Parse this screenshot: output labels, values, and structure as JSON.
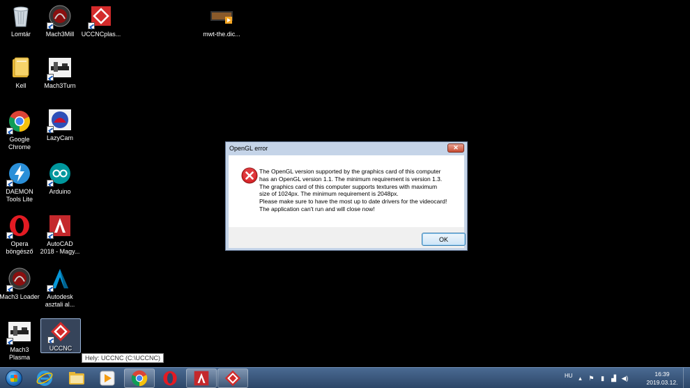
{
  "desktop": {
    "icons": {
      "lomtar": "Lomtár",
      "mach3mill": "Mach3Mill",
      "uccncplas": "UCCNCplas...",
      "mwt": "mwt-the.dic...",
      "kell": "Kell",
      "mach3turn": "Mach3Turn",
      "chrome": "Google\nChrome",
      "lazycam": "LazyCam",
      "daemon": "DAEMON\nTools Lite",
      "arduino": "Arduino",
      "opera": "Opera\nböngésző",
      "autocad": "AutoCAD\n2018 - Magy...",
      "mach3loader": "Mach3 Loader",
      "autodesk": "Autodesk\nasztali al...",
      "mach3plasma": "Mach3\nPlasma",
      "uccnc": "UCCNC"
    },
    "tooltip": "Hely: UCCNC (C:\\UCCNC)"
  },
  "dialog": {
    "title": "OpenGL error",
    "message_lines": [
      "The OpenGL version supported by the graphics card of this computer",
      "has an OpenGL version 1.1. The minimum requirement is version 1.3.",
      "The graphics card of this computer supports textures with maximum",
      "size of 1024px. The minimum requirement is 2048px.",
      "Please make sure to have the most up to date drivers for the videocard!",
      "The application can't run and will close now!"
    ],
    "ok_label": "OK",
    "close_label": "✕"
  },
  "taskbar": {
    "language": "HU",
    "time": "16:39",
    "date": "2019.03.12."
  },
  "colors": {
    "error_red": "#d9262a",
    "taskbar": "#3a5679",
    "dialog_frame": "#c5d4e8"
  }
}
